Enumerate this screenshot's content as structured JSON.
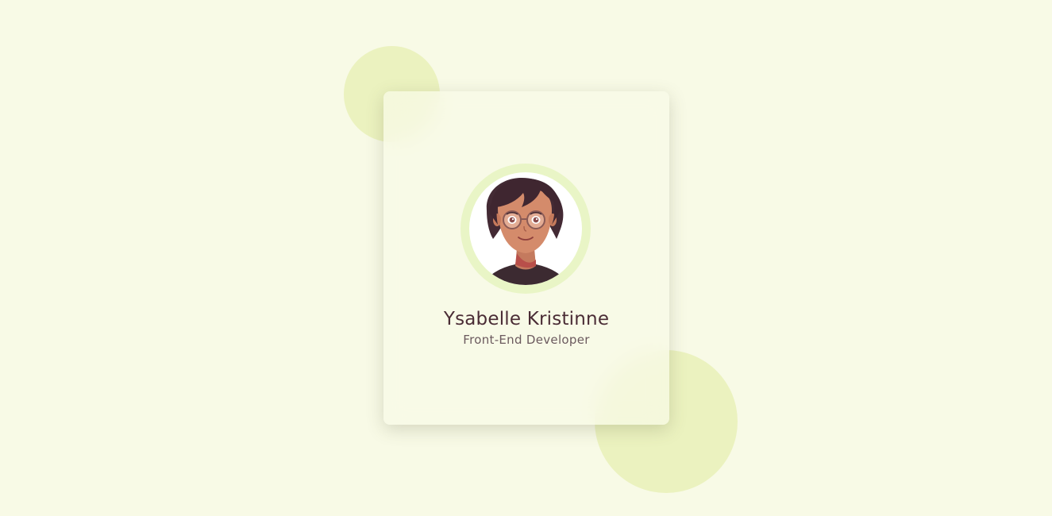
{
  "profile": {
    "name": "Ysabelle Kristinne",
    "role": "Front-End Developer",
    "avatar_icon": "illustrated-person-with-glasses"
  },
  "colors": {
    "background": "#f8fae6",
    "blob": "#ebf2bf",
    "ring": "#e9f5c6",
    "name_text": "#4a2c35",
    "role_text": "#6b5a5e"
  }
}
